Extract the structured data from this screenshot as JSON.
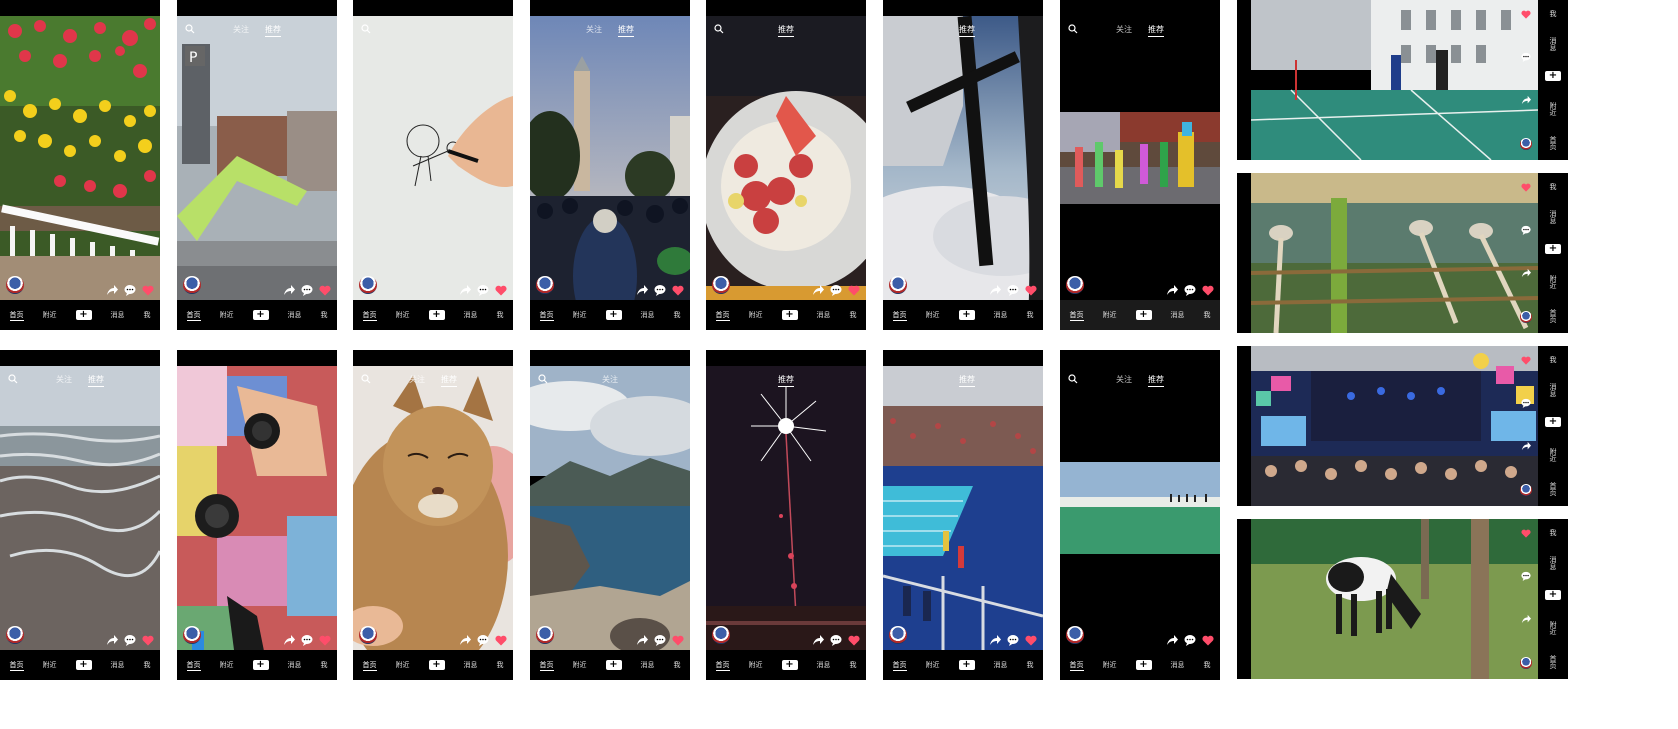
{
  "top_tabs": {
    "follow": "关注",
    "recommend": "推荐"
  },
  "nav": {
    "home": "首页",
    "nearby": "附近",
    "plus": "+",
    "messages": "消息",
    "me": "我"
  },
  "colors": {
    "like": "#ff4d6a",
    "background": "#000000",
    "canvas": "#ffffff"
  },
  "icons": [
    "search-icon",
    "share-icon",
    "comment-icon",
    "heart-icon",
    "avatar",
    "plus-icon"
  ],
  "grid": {
    "row1": [
      "flowers",
      "street-overpass",
      "drawing-hand",
      "campanile-crowd",
      "food-plate",
      "airplane-propeller-clouds",
      "street-parade"
    ],
    "row2": [
      "beach-waves",
      "camera-anime-poster",
      "cat",
      "lake-mountains",
      "fireworks",
      "swimming-pool",
      "salt-lake"
    ]
  },
  "landscape": [
    "badminton-hall",
    "bamboo-water-ladles",
    "strawberry-music-festival",
    "horse-grazing"
  ]
}
